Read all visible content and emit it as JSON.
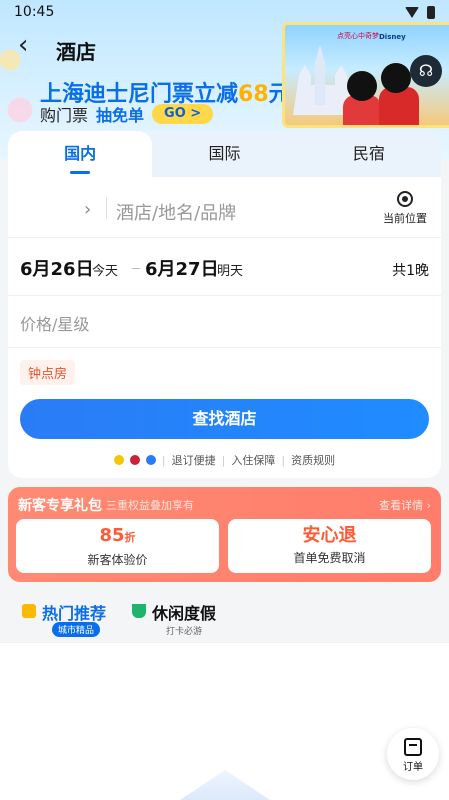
{
  "status_bar": {
    "time": "10:45"
  },
  "header": {
    "title": "酒店"
  },
  "banner": {
    "title_prefix": "上海迪士尼门票立减",
    "title_amount": "68",
    "title_suffix": "元",
    "sub_prefix": "购门票",
    "sub_accent": "抽免单",
    "go_label": "GO >",
    "poster_caption": "点亮心中奇梦",
    "poster_brand": "Disney"
  },
  "tabs": [
    {
      "label": "国内",
      "active": true
    },
    {
      "label": "国际",
      "active": false
    },
    {
      "label": "民宿",
      "active": false
    }
  ],
  "search": {
    "placeholder": "酒店/地名/品牌",
    "location_label": "当前位置"
  },
  "dates": {
    "checkin": "6月26日",
    "checkin_sub": "今天",
    "checkout": "6月27日",
    "checkout_sub": "明天",
    "nights": "共1晚"
  },
  "price_placeholder": "价格/星级",
  "hourly_tag": "钟点房",
  "search_button": "查找酒店",
  "guarantees": [
    "退订便捷",
    "入住保障",
    "资质规则"
  ],
  "gift": {
    "title": "新客专享礼包",
    "subtitle": "三重权益叠加享有",
    "more": "查看详情",
    "coupons": [
      {
        "main": "85",
        "main_unit": "折",
        "sub": "新客体验价"
      },
      {
        "main": "安心退",
        "main_unit": "",
        "sub": "首单免费取消"
      }
    ]
  },
  "categories": [
    {
      "title": "热门推荐",
      "badge": "城市精品"
    },
    {
      "title": "休闲度假",
      "sub": "打卡必游"
    }
  ],
  "order_button": "订单",
  "colors": {
    "accent": "#0a6ee8",
    "coral": "#ff7d6a",
    "yellow": "#ffb300"
  }
}
